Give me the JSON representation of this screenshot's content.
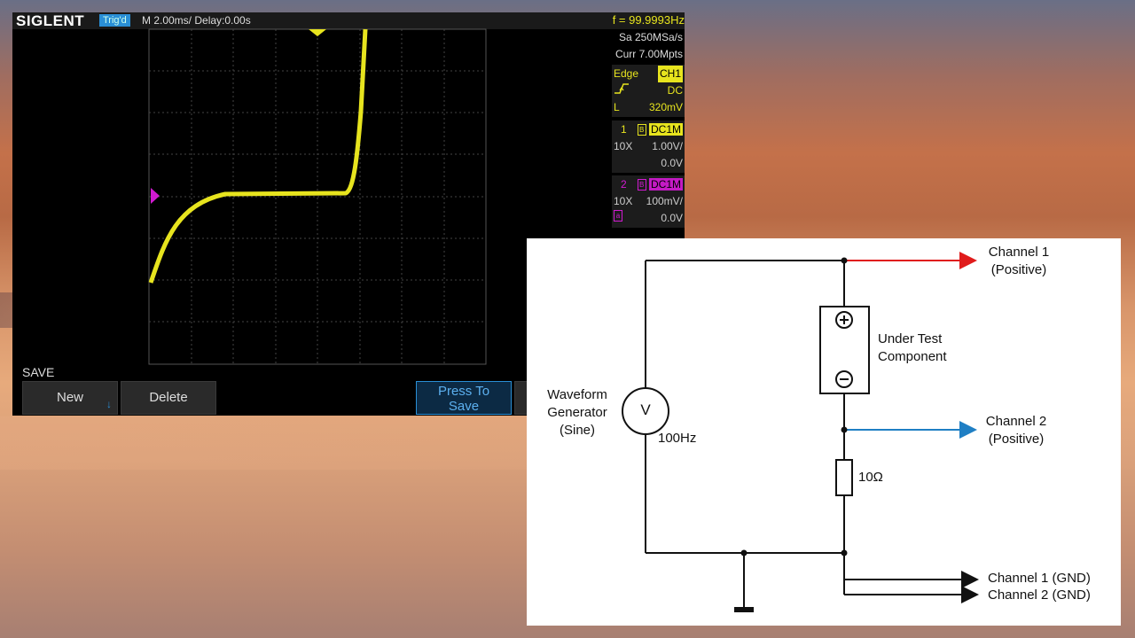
{
  "scope": {
    "brand": "SIGLENT",
    "trigger_status": "Trig'd",
    "timebase": "M 2.00ms/ Delay:0.00s",
    "frequency": "f = 99.9993Hz",
    "sample_rate": "Sa 250MSa/s",
    "memory_depth": "Curr 7.00Mpts",
    "trigger": {
      "type": "Edge",
      "source": "CH1",
      "slope_icon": "rising-edge-icon",
      "coupling": "DC",
      "level_label": "L",
      "level": "320mV"
    },
    "ch1": {
      "number": "1",
      "bw_icon": "B",
      "coupling": "DC1M",
      "probe": "10X",
      "scale": "1.00V/",
      "offset": "0.0V",
      "color": "#e7e41e"
    },
    "ch2": {
      "number": "2",
      "bw_icon": "B",
      "coupling": "DC1M",
      "probe": "10X",
      "scale": "100mV/",
      "marker": "a",
      "offset": "0.0V",
      "color": "#d21ad2"
    },
    "menu": {
      "title": "SAVE",
      "new_label": "New",
      "delete_label": "Delete",
      "press_line1": "Press To",
      "press_line2": "Save"
    },
    "trace_icon": "waveform-trace"
  },
  "circuit": {
    "generator": [
      "Waveform",
      "Generator",
      "(Sine)"
    ],
    "source_symbol": "V",
    "frequency": "100Hz",
    "dut": [
      "Under Test",
      "Component"
    ],
    "resistor": "10Ω",
    "ch1_pos": [
      "Channel 1",
      "(Positive)"
    ],
    "ch2_pos": [
      "Channel 2",
      "(Positive)"
    ],
    "ch1_gnd": "Channel 1 (GND)",
    "ch2_gnd": "Channel 2 (GND)",
    "colors": {
      "ch1_wire": "#e01b1b",
      "ch2_wire": "#1f7fc4",
      "wire": "#111111"
    }
  }
}
